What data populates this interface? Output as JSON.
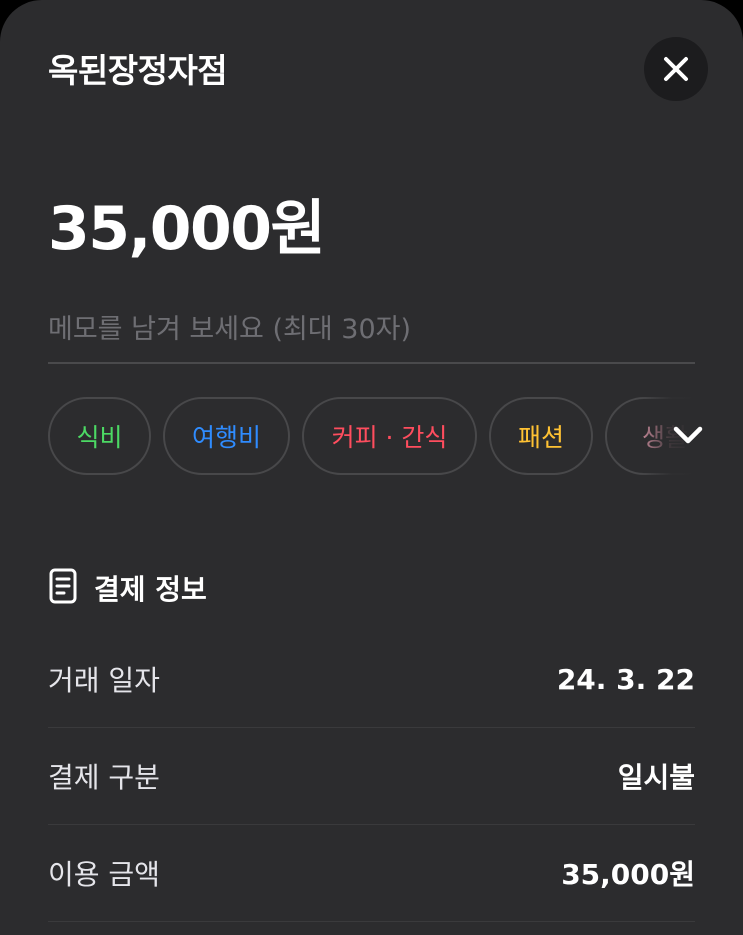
{
  "header": {
    "merchant": "옥된장정자점",
    "close_icon": "close-icon"
  },
  "amount": "35,000원",
  "memo": {
    "placeholder": "메모를 남겨 보세요 (최대 30자)",
    "value": ""
  },
  "categories": [
    {
      "label": "식비",
      "color": "#4cd964"
    },
    {
      "label": "여행비",
      "color": "#2f8cff"
    },
    {
      "label": "커피 · 간식",
      "color": "#ff4d5e"
    },
    {
      "label": "패션",
      "color": "#ffc233"
    },
    {
      "label": "생활",
      "color": "#c98b9b"
    }
  ],
  "categories_expand_icon": "chevron-down-icon",
  "payment_info": {
    "title": "결제 정보",
    "icon": "receipt-icon",
    "rows": [
      {
        "key": "거래 일자",
        "value": "24. 3. 22"
      },
      {
        "key": "결제 구분",
        "value": "일시불"
      },
      {
        "key": "이용 금액",
        "value": "35,000원"
      }
    ]
  }
}
